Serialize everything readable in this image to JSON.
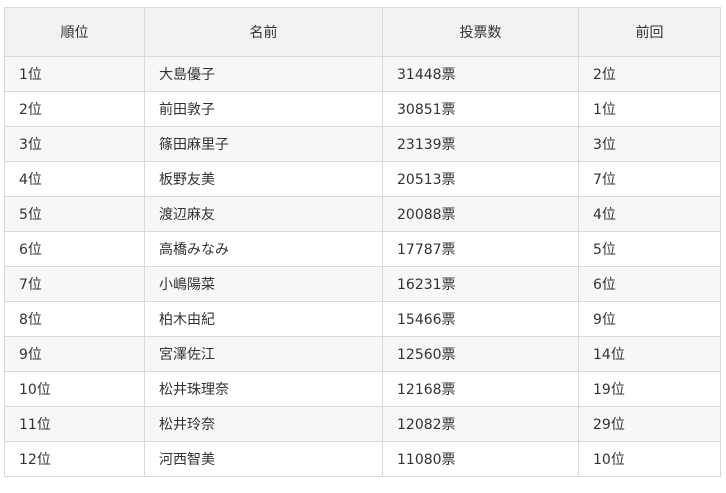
{
  "table": {
    "headers": [
      "順位",
      "名前",
      "投票数",
      "前回"
    ],
    "rows": [
      {
        "rank": "1位",
        "name": "大島優子",
        "votes": "31448票",
        "previous": "2位"
      },
      {
        "rank": "2位",
        "name": "前田敦子",
        "votes": "30851票",
        "previous": "1位"
      },
      {
        "rank": "3位",
        "name": "篠田麻里子",
        "votes": "23139票",
        "previous": "3位"
      },
      {
        "rank": "4位",
        "name": "板野友美",
        "votes": "20513票",
        "previous": "7位"
      },
      {
        "rank": "5位",
        "name": "渡辺麻友",
        "votes": "20088票",
        "previous": "4位"
      },
      {
        "rank": "6位",
        "name": "高橋みなみ",
        "votes": "17787票",
        "previous": "5位"
      },
      {
        "rank": "7位",
        "name": "小嶋陽菜",
        "votes": "16231票",
        "previous": "6位"
      },
      {
        "rank": "8位",
        "name": "柏木由紀",
        "votes": "15466票",
        "previous": "9位"
      },
      {
        "rank": "9位",
        "name": "宮澤佐江",
        "votes": "12560票",
        "previous": "14位"
      },
      {
        "rank": "10位",
        "name": "松井珠理奈",
        "votes": "12168票",
        "previous": "19位"
      },
      {
        "rank": "11位",
        "name": "松井玲奈",
        "votes": "12082票",
        "previous": "29位"
      },
      {
        "rank": "12位",
        "name": "河西智美",
        "votes": "11080票",
        "previous": "10位"
      }
    ]
  }
}
